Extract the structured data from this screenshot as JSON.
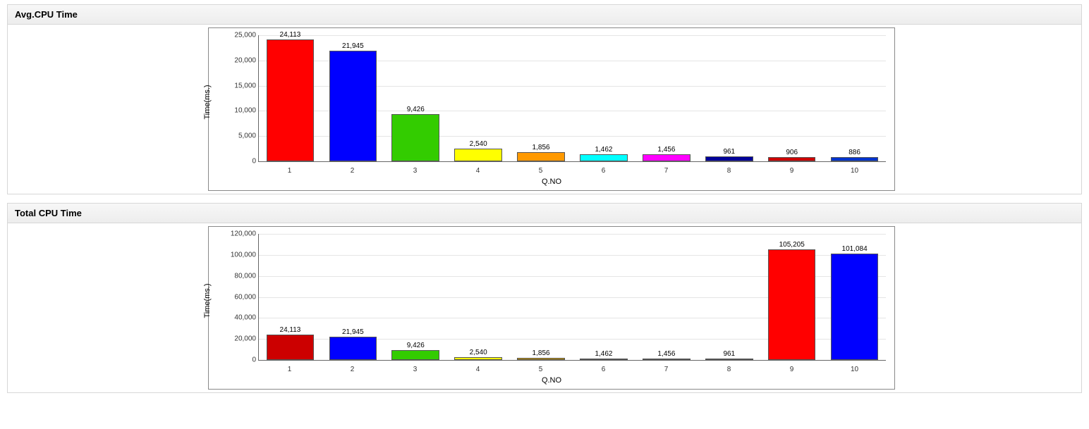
{
  "panels": [
    {
      "id": "avg",
      "title": "Avg.CPU Time"
    },
    {
      "id": "total",
      "title": "Total CPU Time"
    }
  ],
  "axes": {
    "ylabel": "Time(ms.)",
    "xlabel": "Q.NO"
  },
  "chart_data": [
    {
      "id": "avg",
      "type": "bar",
      "title": "Avg.CPU Time",
      "xlabel": "Q.NO",
      "ylabel": "Time(ms.)",
      "ylim": [
        0,
        25000
      ],
      "ystep": 5000,
      "categories": [
        "1",
        "2",
        "3",
        "4",
        "5",
        "6",
        "7",
        "8",
        "9",
        "10"
      ],
      "values": [
        24113,
        21945,
        9426,
        2540,
        1856,
        1462,
        1456,
        961,
        906,
        886
      ],
      "value_labels": [
        "24,113",
        "21,945",
        "9,426",
        "2,540",
        "1,856",
        "1,462",
        "1,456",
        "961",
        "906",
        "886"
      ],
      "colors": [
        "#ff0000",
        "#0000ff",
        "#33cc00",
        "#ffff00",
        "#ff9900",
        "#00ffff",
        "#ff00ff",
        "#000099",
        "#cc0000",
        "#0033cc"
      ]
    },
    {
      "id": "total",
      "type": "bar",
      "title": "Total CPU Time",
      "xlabel": "Q.NO",
      "ylabel": "Time(ms.)",
      "ylim": [
        0,
        120000
      ],
      "ystep": 20000,
      "categories": [
        "1",
        "2",
        "3",
        "4",
        "5",
        "6",
        "7",
        "8",
        "9",
        "10"
      ],
      "values": [
        24113,
        21945,
        9426,
        2540,
        1856,
        1462,
        1456,
        961,
        105205,
        101084
      ],
      "value_labels": [
        "24,113",
        "21,945",
        "9,426",
        "2,540",
        "1,856",
        "1,462",
        "1,456",
        "961",
        "105,205",
        "101,084"
      ],
      "colors": [
        "#cc0000",
        "#0000ff",
        "#33cc00",
        "#ffff00",
        "#cc9900",
        "#009999",
        "#990099",
        "#333333",
        "#ff0000",
        "#0000ff"
      ]
    }
  ]
}
